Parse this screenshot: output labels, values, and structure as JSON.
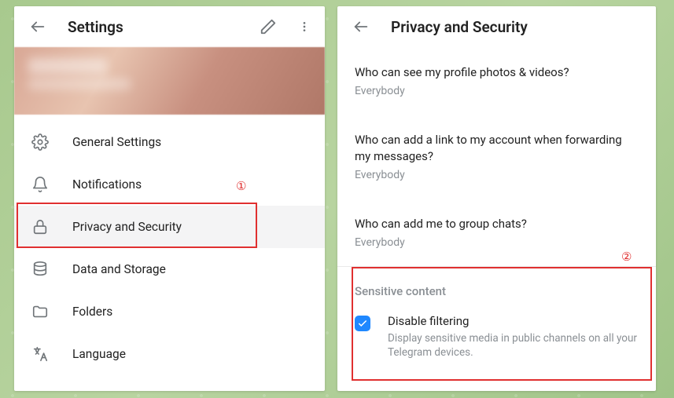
{
  "left": {
    "title": "Settings",
    "menu": [
      {
        "icon": "gear",
        "label": "General Settings"
      },
      {
        "icon": "bell",
        "label": "Notifications"
      },
      {
        "icon": "lock",
        "label": "Privacy and Security",
        "selected": true
      },
      {
        "icon": "db",
        "label": "Data and Storage"
      },
      {
        "icon": "folder",
        "label": "Folders"
      },
      {
        "icon": "lang",
        "label": "Language"
      }
    ]
  },
  "right": {
    "title": "Privacy and Security",
    "items": [
      {
        "q": "Who can see my profile photos & videos?",
        "v": "Everybody"
      },
      {
        "q": "Who can add a link to my account when forwarding my messages?",
        "v": "Everybody"
      },
      {
        "q": "Who can add me to group chats?",
        "v": "Everybody"
      }
    ],
    "section": "Sensitive content",
    "check": {
      "checked": true,
      "title": "Disable filtering",
      "desc": "Display sensitive media in public channels on all your Telegram devices."
    }
  },
  "annotations": {
    "num1": "①",
    "num2": "②"
  }
}
